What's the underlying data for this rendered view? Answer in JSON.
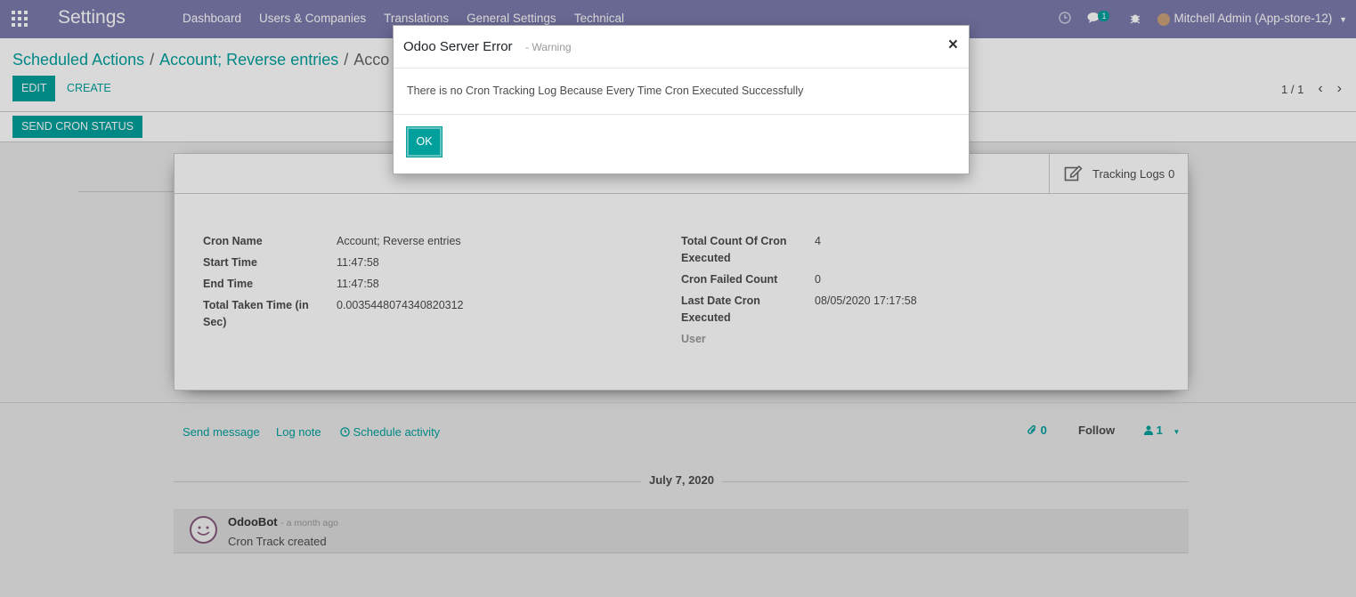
{
  "navbar": {
    "brand": "Settings",
    "menu": [
      "Dashboard",
      "Users & Companies",
      "Translations",
      "General Settings",
      "Technical"
    ],
    "messages_count": "1",
    "user": "Mitchell Admin (App-store-12)"
  },
  "breadcrumb": {
    "item1": "Scheduled Actions",
    "item2": "Account; Reverse entries",
    "item3": "Acco"
  },
  "buttons": {
    "edit": "EDIT",
    "create": "CREATE",
    "send_cron_status": "SEND CRON STATUS"
  },
  "pager": {
    "value": "1 / 1"
  },
  "smart_button": {
    "label": "Tracking Logs",
    "count": "0"
  },
  "form": {
    "left": [
      {
        "label": "Cron Name",
        "value": "Account; Reverse entries"
      },
      {
        "label": "Start Time",
        "value": "11:47:58"
      },
      {
        "label": "End Time",
        "value": "11:47:58"
      },
      {
        "label": "Total Taken Time (in Sec)",
        "value": "0.0035448074340820312"
      }
    ],
    "right": [
      {
        "label": "Total Count Of Cron Executed",
        "value": "4"
      },
      {
        "label": "Cron Failed Count",
        "value": "0"
      },
      {
        "label": "Last Date Cron Executed",
        "value": "08/05/2020 17:17:58"
      },
      {
        "label": "User",
        "value": ""
      }
    ]
  },
  "chatter": {
    "send_message": "Send message",
    "log_note": "Log note",
    "schedule_activity": "Schedule activity",
    "attachments": "0",
    "follow": "Follow",
    "followers": "1",
    "date": "July 7, 2020",
    "message": {
      "author": "OdooBot",
      "time": "- a month ago",
      "body": "Cron Track created"
    }
  },
  "modal": {
    "title": "Odoo Server Error",
    "subtitle": "- Warning",
    "close": "×",
    "body": "There is no Cron Tracking Log Because Every Time Cron Executed Successfully",
    "ok": "OK"
  }
}
